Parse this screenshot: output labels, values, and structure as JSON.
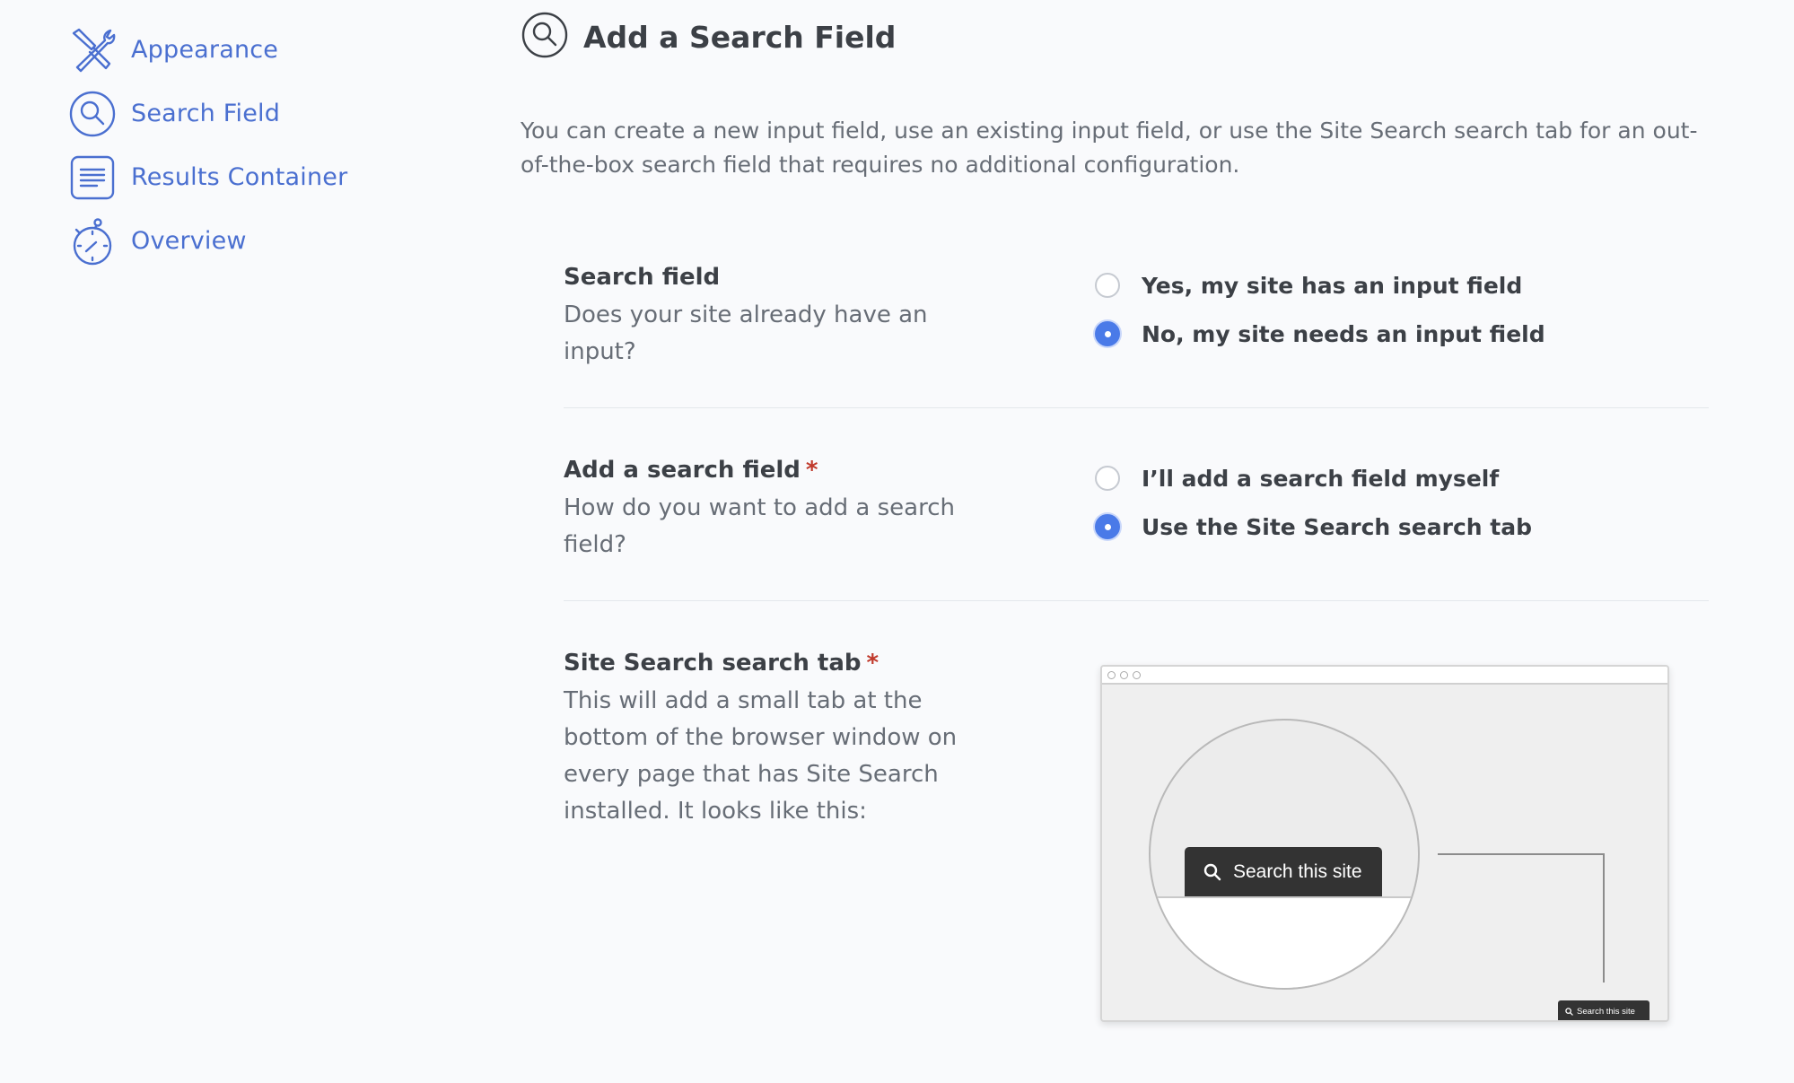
{
  "sidebar": {
    "items": [
      {
        "label": "Appearance",
        "icon": "tools-icon"
      },
      {
        "label": "Search Field",
        "icon": "search-icon"
      },
      {
        "label": "Results Container",
        "icon": "list-icon"
      },
      {
        "label": "Overview",
        "icon": "stopwatch-icon"
      }
    ]
  },
  "header": {
    "title": "Add a Search Field",
    "icon": "search-icon"
  },
  "intro": "You can create a new input field, use an existing input field, or use the Site Search search tab for an out-of-the-box search field that requires no additional configuration.",
  "sections": {
    "search_field": {
      "title": "Search field",
      "description": "Does your site already have an input?",
      "options": [
        {
          "label": "Yes, my site has an input field",
          "checked": false
        },
        {
          "label": "No, my site needs an input field",
          "checked": true
        }
      ]
    },
    "add_search_field": {
      "title": "Add a search field",
      "required_mark": "*",
      "description": "How do you want to add a search field?",
      "options": [
        {
          "label": "I’ll add a search field myself",
          "checked": false
        },
        {
          "label": "Use the Site Search search tab",
          "checked": true
        }
      ]
    },
    "search_tab": {
      "title": "Site Search search tab",
      "required_mark": "*",
      "description": "This will add a small tab at the bottom of the browser window on every page that has Site Search installed. It looks like this:",
      "preview": {
        "tab_label": "Search this site",
        "tab_label_small": "Search this site"
      }
    }
  },
  "colors": {
    "accent": "#4a6fd0",
    "radio_checked": "#4a7ae8",
    "required": "#c0392b",
    "background": "#f9fafc"
  }
}
